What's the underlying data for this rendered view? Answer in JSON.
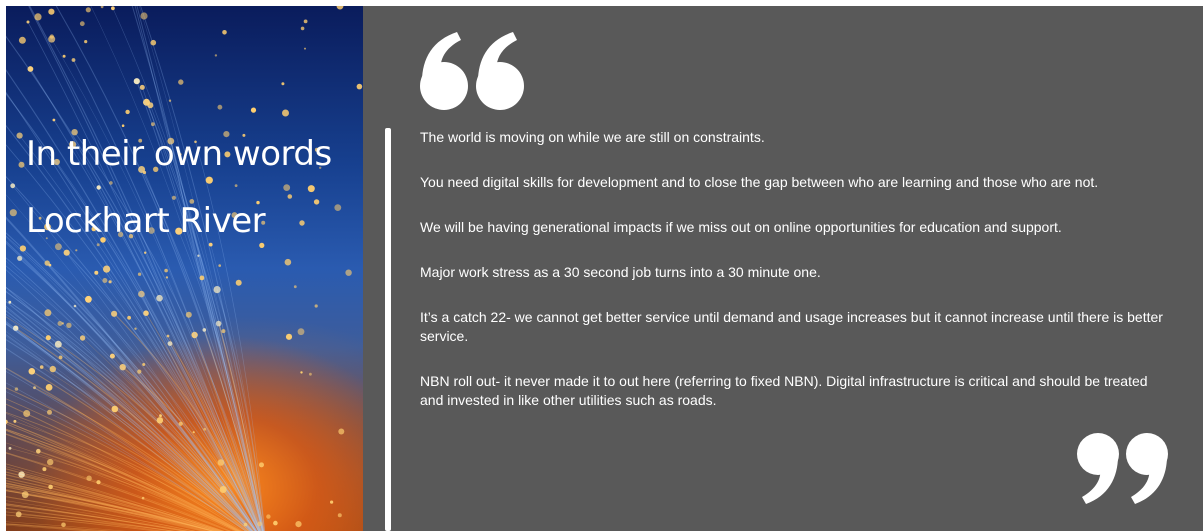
{
  "slide": {
    "title_line1": "In their own words",
    "title_line2": "Lockhart River",
    "quotes": [
      "The world is moving on while we are still on constraints.",
      "You need digital skills for development and to close the gap between who are learning and those who are not.",
      "We will be having generational impacts if we miss out on online opportunities for education and support.",
      "Major work stress as a 30 second job turns into a 30 minute one.",
      "It’s a catch 22- we cannot get better service until demand and usage increases but it cannot increase until there is better service.",
      "NBN roll out- it never made it to out here (referring to fixed NBN). Digital infrastructure is critical and should be treated and invested in like other utilities such as roads."
    ]
  },
  "icons": {
    "open_quote": "open-quote-icon",
    "close_quote": "close-quote-icon",
    "background_image": "fiber-optic-lights-image"
  },
  "colors": {
    "quote_panel": "#595959",
    "text": "#ffffff",
    "photo_blue": "#17408f",
    "photo_orange": "#ff8c1e"
  }
}
